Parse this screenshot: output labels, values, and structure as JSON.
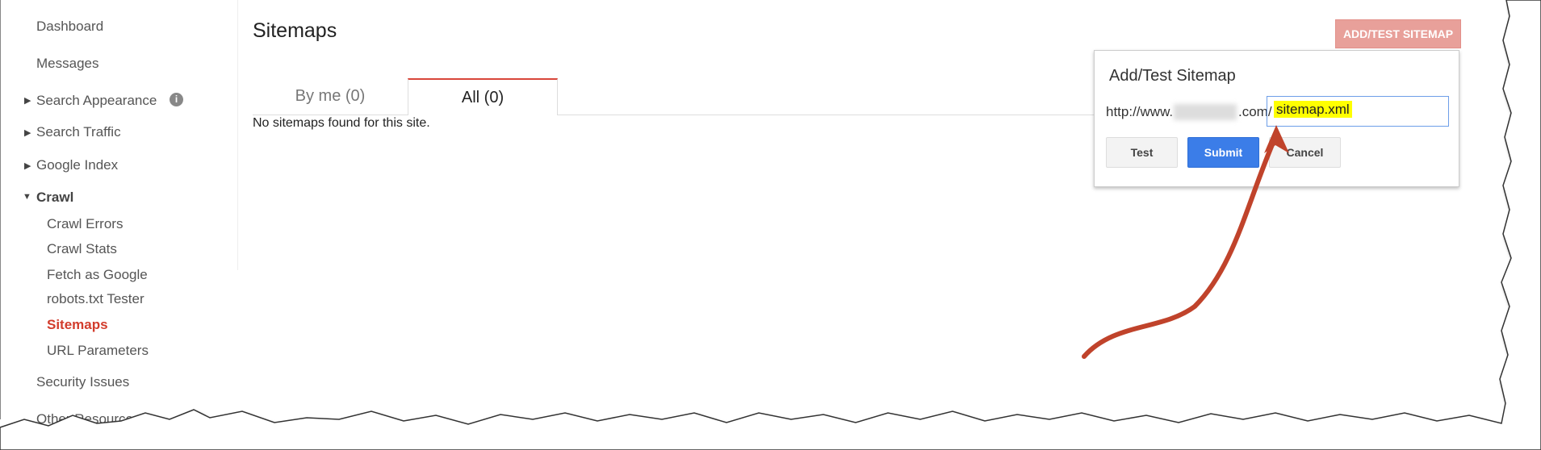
{
  "sidebar": {
    "items": [
      {
        "label": "Dashboard"
      },
      {
        "label": "Messages"
      },
      {
        "label": "Search Appearance"
      },
      {
        "label": "Search Traffic"
      },
      {
        "label": "Google Index"
      },
      {
        "label": "Crawl"
      },
      {
        "label": "Crawl Errors"
      },
      {
        "label": "Crawl Stats"
      },
      {
        "label": "Fetch as Google"
      },
      {
        "label": "robots.txt Tester"
      },
      {
        "label": "Sitemaps"
      },
      {
        "label": "URL Parameters"
      },
      {
        "label": "Security Issues"
      },
      {
        "label": "Other Resources"
      }
    ]
  },
  "main": {
    "title": "Sitemaps",
    "tabs": [
      {
        "label": "By me (0)"
      },
      {
        "label": "All (0)"
      }
    ],
    "active_tab": "All (0)",
    "empty_message": "No sitemaps found for this site.",
    "add_button": "ADD/TEST SITEMAP"
  },
  "popup": {
    "title": "Add/Test Sitemap",
    "url_prefix": "http://www.",
    "url_suffix": ".com/",
    "input_value": "sitemap.xml",
    "buttons": {
      "test": "Test",
      "submit": "Submit",
      "cancel": "Cancel"
    }
  },
  "colors": {
    "accent": "#d23c2c",
    "submit": "#3b7de8",
    "highlight": "#ffff00",
    "arrow": "#c0432b"
  }
}
